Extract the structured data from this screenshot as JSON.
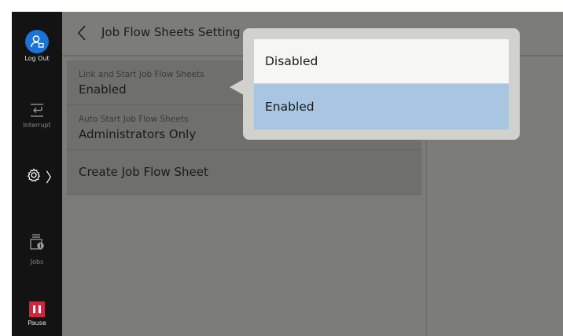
{
  "sidebar": {
    "logout_label": "Log Out",
    "interrupt_label": "Interrupt",
    "jobs_label": "Jobs",
    "pause_label": "Pause",
    "settings_chevron": "〉"
  },
  "header": {
    "back_glyph": "‹",
    "title": "Job Flow Sheets Setting"
  },
  "settings": [
    {
      "label": "Link and Start Job Flow Sheets",
      "value": "Enabled"
    },
    {
      "label": "Auto Start Job Flow Sheets",
      "value": "Administrators Only"
    }
  ],
  "create_label": "Create Job Flow Sheet",
  "dropdown": {
    "options": [
      "Disabled",
      "Enabled"
    ],
    "selected": "Enabled"
  },
  "colors": {
    "sidebar_bg": "#131313",
    "logout_accent": "#1a73d6",
    "pause_accent": "#d2233f",
    "selected_option": "#a8c6e1"
  }
}
